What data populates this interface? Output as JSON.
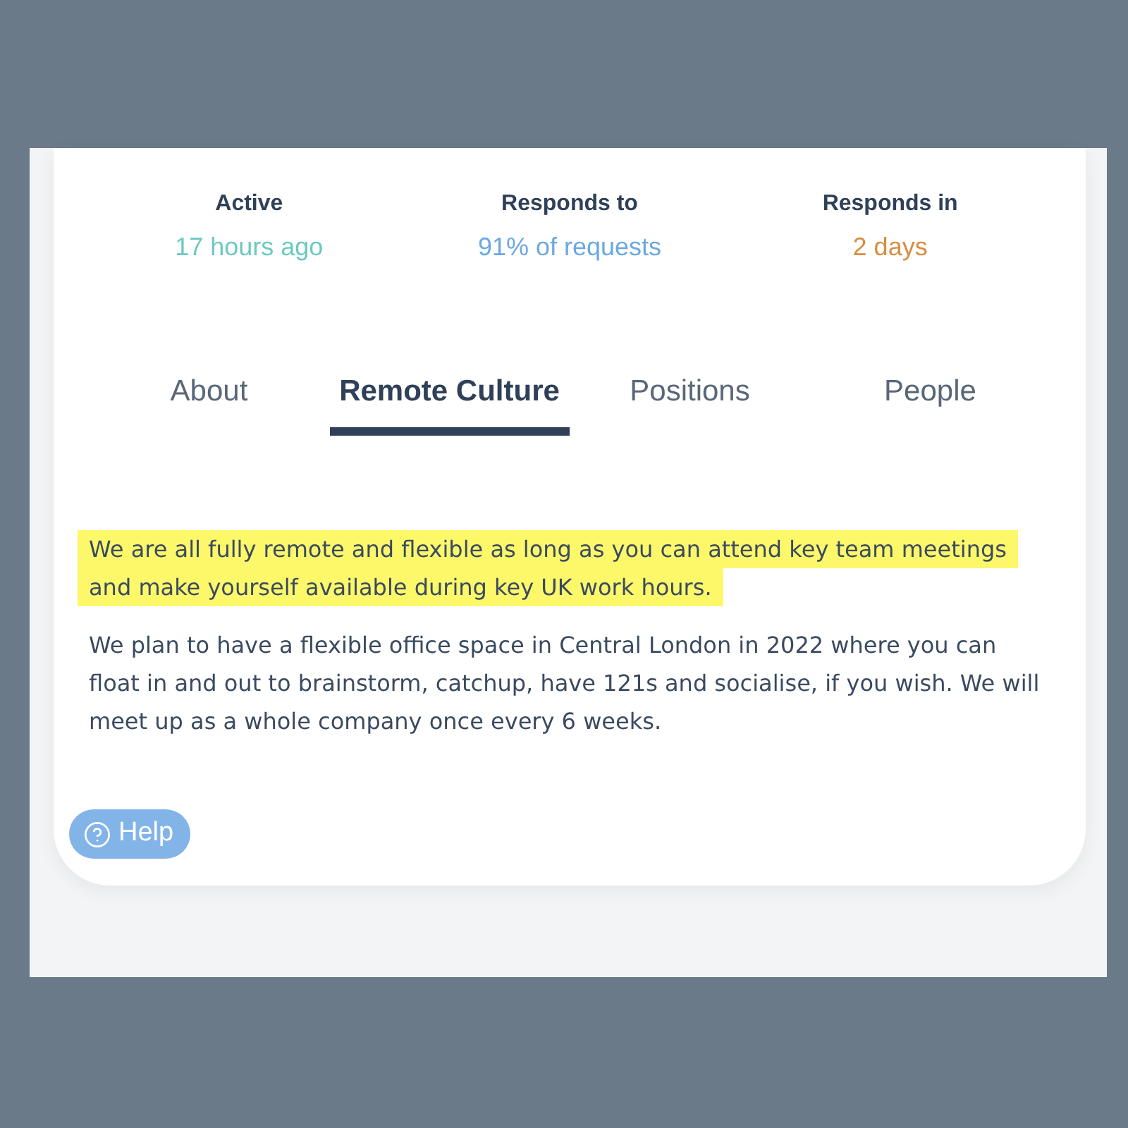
{
  "stats": [
    {
      "label": "Active",
      "value": "17 hours ago",
      "color": "#6cc9c0"
    },
    {
      "label": "Responds to",
      "value": "91% of requests",
      "color": "#6aa8e2"
    },
    {
      "label": "Responds in",
      "value": "2 days",
      "color": "#d98c40"
    }
  ],
  "tabs": [
    {
      "label": "About",
      "selected": false
    },
    {
      "label": "Remote Culture",
      "selected": true
    },
    {
      "label": "Positions",
      "selected": false
    },
    {
      "label": "People",
      "selected": false
    }
  ],
  "paragraphs": [
    {
      "text": "We are all fully remote and flexible as long as you can attend key team meetings and make yourself available during key UK work hours.",
      "highlighted": true
    },
    {
      "text": "We plan to have a flexible office space in Central London in 2022 where you can float in and out to brainstorm, catchup, have 121s and socialise, if you wish. We will meet up as a whole company once every 6 weeks.",
      "highlighted": false
    }
  ],
  "help_button": {
    "label": "Help"
  }
}
